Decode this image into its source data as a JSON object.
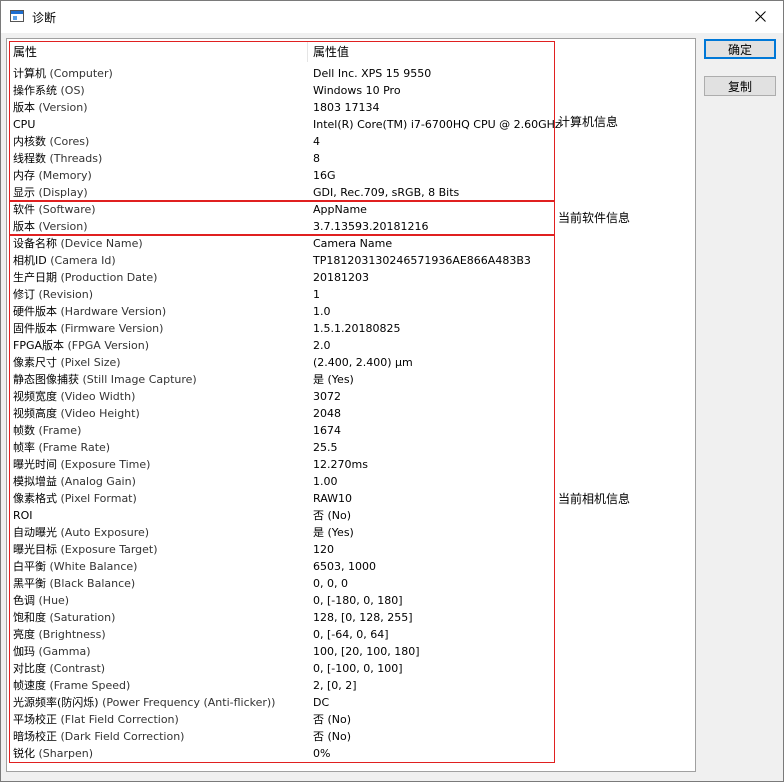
{
  "window": {
    "title": "诊断",
    "icon": "app-window-icon"
  },
  "buttons": {
    "ok": "确定",
    "copy": "复制"
  },
  "table": {
    "header": {
      "name": "属性",
      "value": "属性值"
    },
    "groups": [
      {
        "label": "计算机信息",
        "rows": [
          {
            "name_cn": "计算机",
            "name_en": "(Computer)",
            "value": "Dell Inc. XPS 15 9550"
          },
          {
            "name_cn": "操作系统",
            "name_en": "(OS)",
            "value": "Windows 10 Pro"
          },
          {
            "name_cn": "版本",
            "name_en": "(Version)",
            "value": "1803 17134"
          },
          {
            "name_cn": "CPU",
            "name_en": "",
            "value": "Intel(R) Core(TM) i7-6700HQ CPU @ 2.60GHz"
          },
          {
            "name_cn": "内核数",
            "name_en": "(Cores)",
            "value": "4"
          },
          {
            "name_cn": "线程数",
            "name_en": "(Threads)",
            "value": "8"
          },
          {
            "name_cn": "内存",
            "name_en": "(Memory)",
            "value": "16G"
          },
          {
            "name_cn": "显示",
            "name_en": "(Display)",
            "value": "GDI, Rec.709, sRGB, 8 Bits"
          }
        ]
      },
      {
        "label": "当前软件信息",
        "rows": [
          {
            "name_cn": "软件",
            "name_en": "(Software)",
            "value": "AppName"
          },
          {
            "name_cn": "版本",
            "name_en": "(Version)",
            "value": "3.7.13593.20181216"
          }
        ]
      },
      {
        "label": "当前相机信息",
        "rows": [
          {
            "name_cn": "设备名称",
            "name_en": "(Device Name)",
            "value": "Camera Name"
          },
          {
            "name_cn": "相机ID",
            "name_en": "(Camera Id)",
            "value": "TP18120313024657193​6AE866A483B3"
          },
          {
            "name_cn": "生产日期",
            "name_en": "(Production Date)",
            "value": "20181203"
          },
          {
            "name_cn": "修订",
            "name_en": "(Revision)",
            "value": "1"
          },
          {
            "name_cn": "硬件版本",
            "name_en": "(Hardware Version)",
            "value": "1.0"
          },
          {
            "name_cn": "固件版本",
            "name_en": "(Firmware Version)",
            "value": "1.5.1.20180825"
          },
          {
            "name_cn": "FPGA版本",
            "name_en": "(FPGA Version)",
            "value": "2.0"
          },
          {
            "name_cn": "像素尺寸",
            "name_en": "(Pixel Size)",
            "value": "(2.400, 2.400) μm"
          },
          {
            "name_cn": "静态图像捕获",
            "name_en": "(Still Image Capture)",
            "value": "是 (Yes)"
          },
          {
            "name_cn": "视频宽度",
            "name_en": "(Video Width)",
            "value": "3072"
          },
          {
            "name_cn": "视频高度",
            "name_en": "(Video Height)",
            "value": "2048"
          },
          {
            "name_cn": "帧数",
            "name_en": "(Frame)",
            "value": "1674"
          },
          {
            "name_cn": "帧率",
            "name_en": "(Frame Rate)",
            "value": "25.5"
          },
          {
            "name_cn": "曝光时间",
            "name_en": "(Exposure Time)",
            "value": "12.270ms"
          },
          {
            "name_cn": "模拟增益",
            "name_en": "(Analog Gain)",
            "value": "1.00"
          },
          {
            "name_cn": "像素格式",
            "name_en": "(Pixel Format)",
            "value": "RAW10"
          },
          {
            "name_cn": "ROI",
            "name_en": "",
            "value": "否 (No)"
          },
          {
            "name_cn": "自动曝光",
            "name_en": "(Auto Exposure)",
            "value": "是 (Yes)"
          },
          {
            "name_cn": "曝光目标",
            "name_en": "(Exposure Target)",
            "value": "120"
          },
          {
            "name_cn": "白平衡",
            "name_en": "(White Balance)",
            "value": "6503, 1000"
          },
          {
            "name_cn": "黑平衡",
            "name_en": "(Black Balance)",
            "value": "0, 0, 0"
          },
          {
            "name_cn": "色调",
            "name_en": "(Hue)",
            "value": "0, [-180, 0, 180]"
          },
          {
            "name_cn": "饱和度",
            "name_en": "(Saturation)",
            "value": "128, [0, 128, 255]"
          },
          {
            "name_cn": "亮度",
            "name_en": "(Brightness)",
            "value": "0, [-64, 0, 64]"
          },
          {
            "name_cn": "伽玛",
            "name_en": "(Gamma)",
            "value": "100, [20, 100, 180]"
          },
          {
            "name_cn": "对比度",
            "name_en": "(Contrast)",
            "value": "0, [-100, 0, 100]"
          },
          {
            "name_cn": "帧速度",
            "name_en": "(Frame Speed)",
            "value": "2, [0, 2]"
          },
          {
            "name_cn": "光源频率(防闪烁)",
            "name_en": "(Power Frequency (Anti-flicker))",
            "value": "DC"
          },
          {
            "name_cn": "平场校正",
            "name_en": "(Flat Field Correction)",
            "value": "否 (No)"
          },
          {
            "name_cn": "暗场校正",
            "name_en": "(Dark Field Correction)",
            "value": "否 (No)"
          },
          {
            "name_cn": "锐化",
            "name_en": "(Sharpen)",
            "value": "0%"
          }
        ]
      }
    ]
  },
  "colors": {
    "highlight_border": "#e02020",
    "default_button_border": "#0078d7"
  }
}
